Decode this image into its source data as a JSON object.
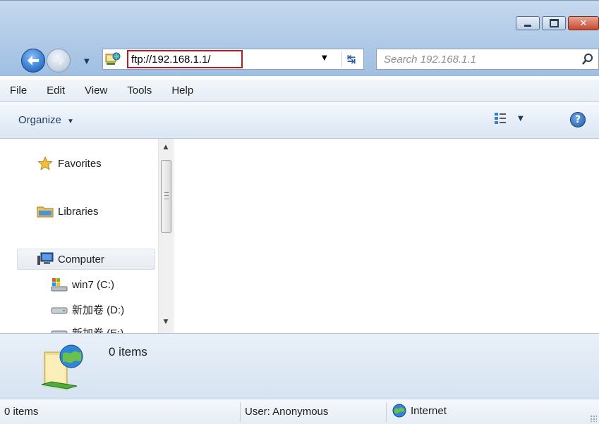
{
  "window": {
    "caption_buttons": [
      "minimize",
      "maximize",
      "close"
    ]
  },
  "nav": {
    "address": "ftp://192.168.1.1/",
    "search_placeholder": "Search 192.168.1.1"
  },
  "menu": {
    "items": [
      "File",
      "Edit",
      "View",
      "Tools",
      "Help"
    ]
  },
  "command_bar": {
    "organize_label": "Organize"
  },
  "sidebar": {
    "favorites": "Favorites",
    "libraries": "Libraries",
    "computer": "Computer",
    "drives": [
      "win7 (C:)",
      "新加卷 (D:)",
      "新加卷 (E:)"
    ]
  },
  "details": {
    "count": "0 items"
  },
  "status": {
    "items": "0 items",
    "user": "User: Anonymous",
    "zone": "Internet"
  },
  "colors": {
    "address_highlight": "#b81d23",
    "glass": "#aac6e6"
  }
}
